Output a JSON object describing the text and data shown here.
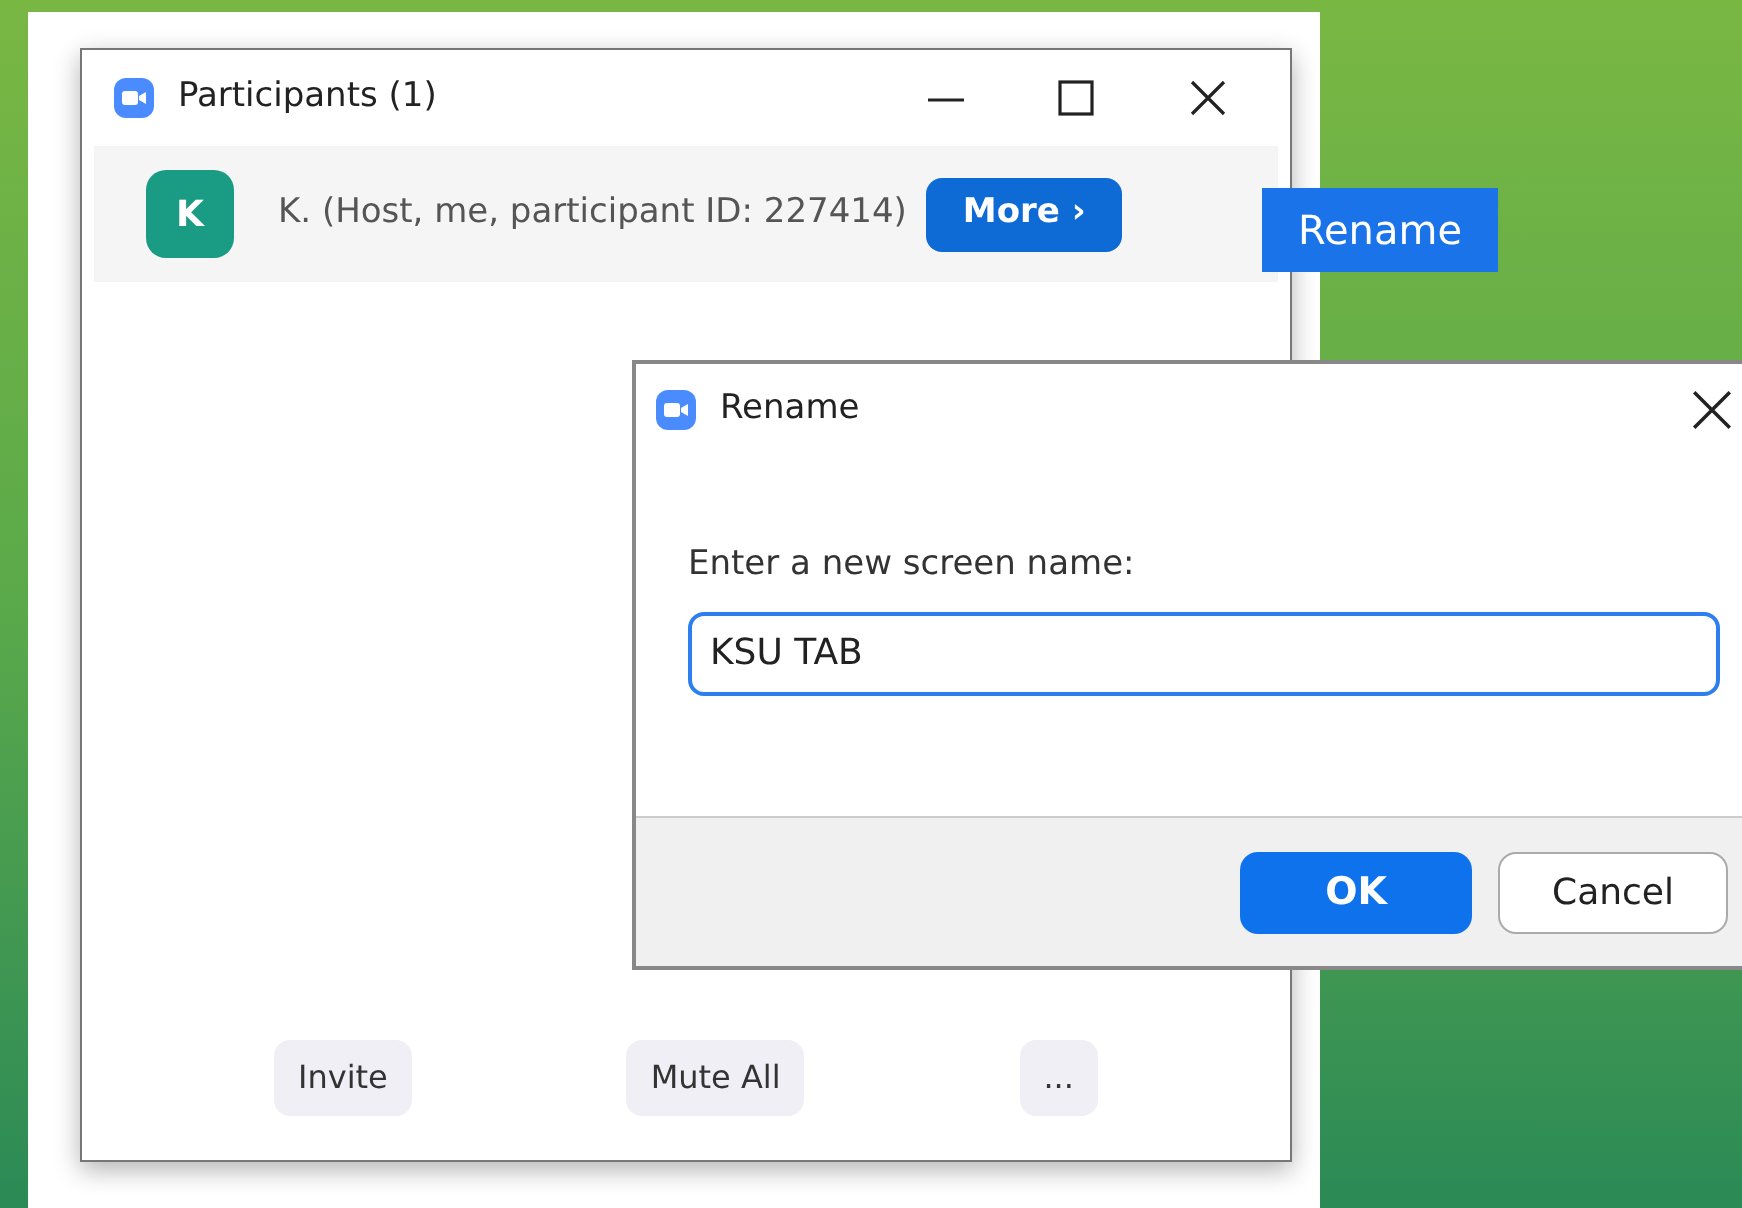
{
  "participants_window": {
    "title": "Participants (1)",
    "participants": [
      {
        "initial": "K",
        "name": "K. (Host, me, participant ID: 227414)",
        "color": "#1a9c84",
        "more_button": "More ›"
      }
    ],
    "footer_buttons": [
      "Invite",
      "Mute All",
      "..."
    ]
  },
  "tooltip": "Rename",
  "rename_dialog": {
    "title": "Rename",
    "prompt": "Enter a new screen name:",
    "value": "KSU TAB",
    "ok": "OK",
    "cancel": "Cancel"
  }
}
